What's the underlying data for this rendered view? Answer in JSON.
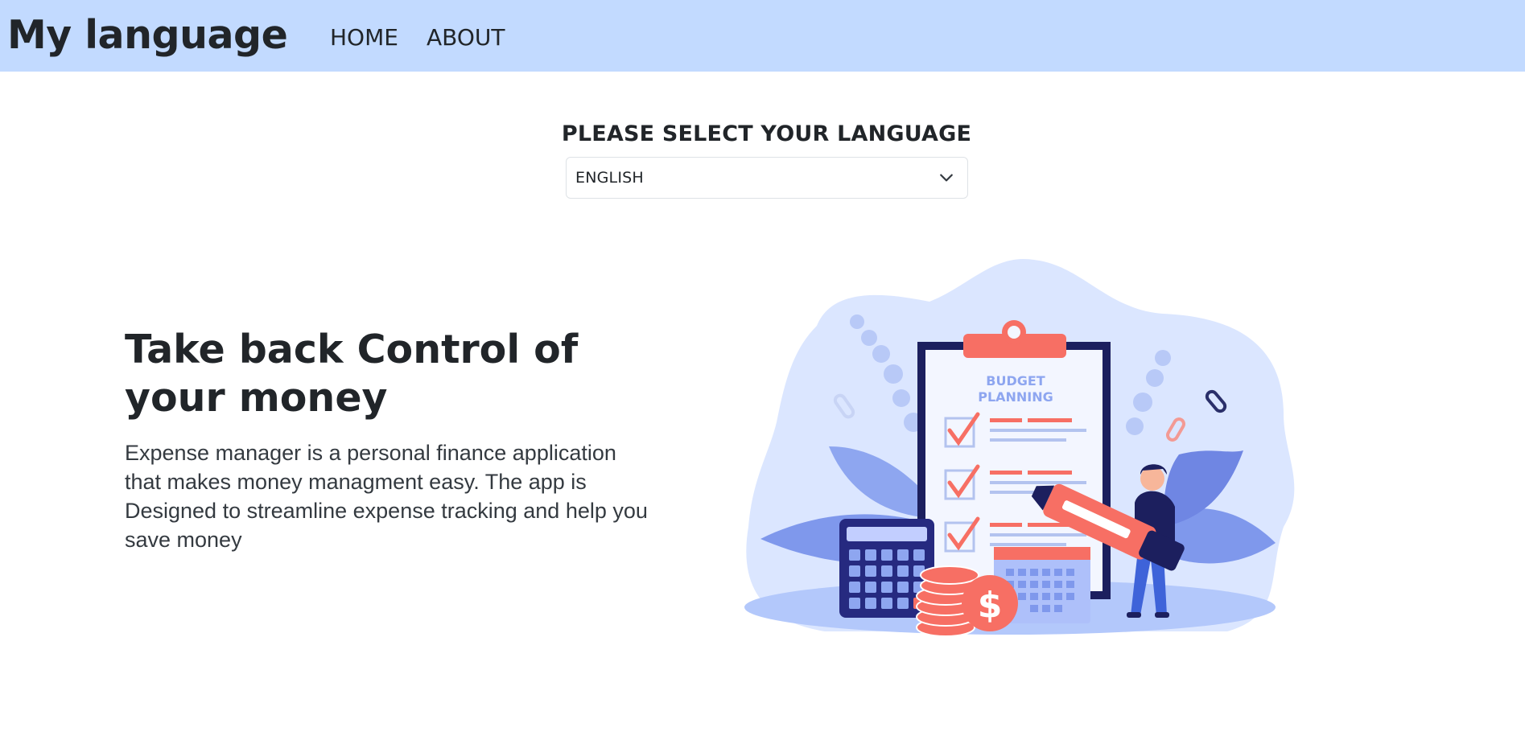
{
  "navbar": {
    "brand": "My language",
    "links": [
      {
        "label": "HOME"
      },
      {
        "label": "ABOUT"
      }
    ]
  },
  "language": {
    "heading": "PLEASE SELECT YOUR LANGUAGE",
    "selected": "ENGLISH"
  },
  "hero": {
    "title": "Take back Control of your money",
    "description": "Expense manager is a personal finance application that makes money managment easy. The app is Designed to streamline expense tracking and help you save money"
  },
  "illustration": {
    "clipboard_title_line1": "BUDGET",
    "clipboard_title_line2": "PLANNING",
    "coin_symbol": "$"
  },
  "colors": {
    "navbar_bg": "#c2daff",
    "accent_coral": "#f76f64",
    "navy": "#1c1f5e",
    "light_blue": "#dbe6ff"
  }
}
